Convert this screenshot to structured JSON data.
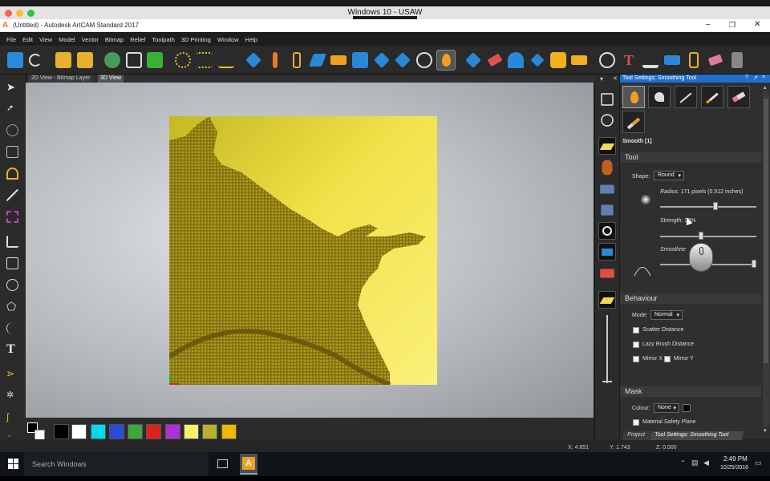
{
  "os_window_title": "Windows 10 - USAW",
  "app_title": "(Untitled) - Autodesk ArtCAM Standard 2017",
  "menu": [
    "File",
    "Edit",
    "View",
    "Model",
    "Vector",
    "Bitmap",
    "Relief",
    "Toolpath",
    "3D Printing",
    "Window",
    "Help"
  ],
  "view_tabs": [
    "2D View - Bitmap Layer",
    "3D View"
  ],
  "panel": {
    "title": "Tool Settings: Smoothing Tool",
    "header_icons": [
      "?",
      "↗",
      "×"
    ],
    "tool_name": "Smooth [1]",
    "tool_section": "Tool",
    "shape_label": "Shape:",
    "shape_value": "Round",
    "radius_label": "Radius:",
    "radius_value": "171 pixels (0.512 inches)",
    "radius_fraction": 0.58,
    "strength_label": "Strength:",
    "strength_value": "33%",
    "strength_fraction": 0.42,
    "smoothness_label": "Smoothne",
    "smoothness_fraction": 1.0,
    "behaviour_section": "Behaviour",
    "mode_label": "Mode:",
    "mode_value": "Normal",
    "scatter_label": "Scatter Distance",
    "lazy_label": "Lazy Brush Distance",
    "mirror_x_label": "Mirror X",
    "mirror_y_label": "Mirror Y",
    "mask_section": "Mask",
    "colour_label": "Colour:",
    "colour_value": "None",
    "safety_label": "Material Safety Plane"
  },
  "bottom_tabs": [
    "Project",
    "Tool Settings: Smoothing Tool"
  ],
  "status": {
    "x": "X: 4.651",
    "y": "Y: 1.743",
    "z": "Z: 0.000"
  },
  "palette_colors": [
    "#000000",
    "#ffffff",
    "#00d8f0",
    "#2a4ad8",
    "#3aa83a",
    "#e02020",
    "#b030d8",
    "#f4f070",
    "#b8b030",
    "#f0b800"
  ],
  "taskbar": {
    "search": "Search Windows",
    "time": "2:49 PM",
    "date": "10/25/2016"
  }
}
